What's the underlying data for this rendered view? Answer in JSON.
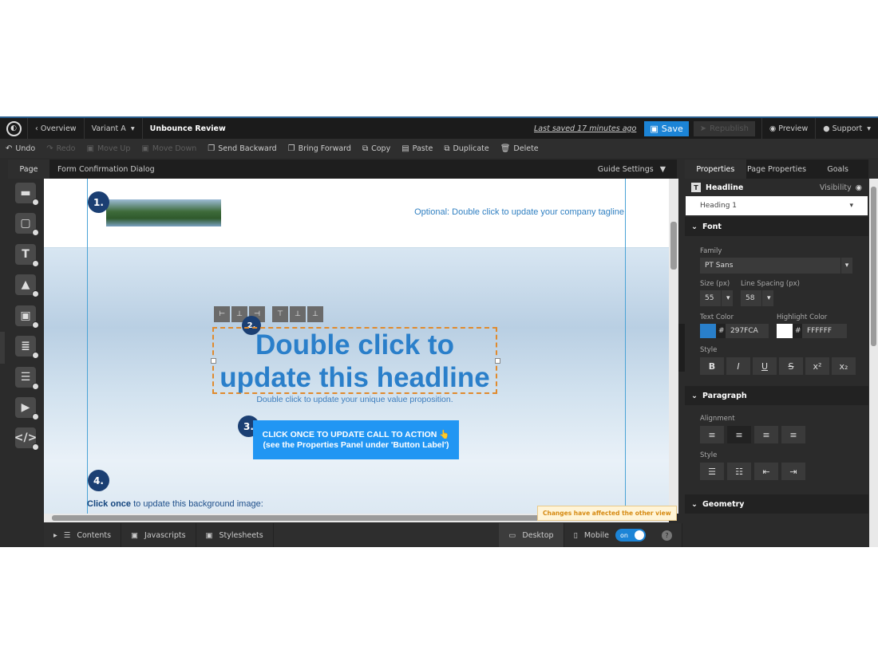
{
  "topbar": {
    "overview": "Overview",
    "variant": "Variant A",
    "page_name": "Unbounce Review",
    "last_saved": "Last saved  17 minutes ago",
    "save": "Save",
    "republish": "Republish",
    "preview": "Preview",
    "support": "Support"
  },
  "toolbar": {
    "undo": "Undo",
    "redo": "Redo",
    "move_up": "Move Up",
    "move_down": "Move Down",
    "send_backward": "Send Backward",
    "bring_forward": "Bring Forward",
    "copy": "Copy",
    "paste": "Paste",
    "duplicate": "Duplicate",
    "delete": "Delete"
  },
  "pagebar": {
    "page_tab": "Page",
    "breadcrumb": "Form Confirmation Dialog",
    "guide_settings": "Guide Settings"
  },
  "canvas": {
    "tagline": "Optional: Double click to update your company tagline",
    "headline": "Double click to update this headline",
    "uvp": "Double click to update your unique value proposition.",
    "cta": "CLICK ONCE TO UPDATE CALL TO ACTION 👆 (see the Properties Panel under 'Button Label')",
    "bg_bold": "Click once",
    "bg_rest": " to update this background image:",
    "markers": [
      "1.",
      "2.",
      "3.",
      "4."
    ],
    "toast": "Changes have affected the other view"
  },
  "bottombar": {
    "contents": "Contents",
    "javascripts": "Javascripts",
    "stylesheets": "Stylesheets",
    "desktop": "Desktop",
    "mobile": "Mobile",
    "toggle": "on"
  },
  "panel": {
    "tabs": [
      "Properties",
      "Page Properties",
      "Goals"
    ],
    "element": "Headline",
    "visibility": "Visibility",
    "heading_level": "Heading 1",
    "font_section": "Font",
    "family_label": "Family",
    "family": "PT Sans",
    "size_label": "Size (px)",
    "size": "55",
    "line_spacing_label": "Line Spacing (px)",
    "line_spacing": "58",
    "text_color_label": "Text Color",
    "text_color": "297FCA",
    "highlight_label": "Highlight Color",
    "highlight_color": "FFFFFF",
    "style_label": "Style",
    "paragraph_section": "Paragraph",
    "alignment_label": "Alignment",
    "pstyle_label": "Style",
    "geometry_section": "Geometry"
  },
  "colors": {
    "accent": "#1c84d6",
    "headline": "#297FCA",
    "marker": "#1b3f73"
  }
}
